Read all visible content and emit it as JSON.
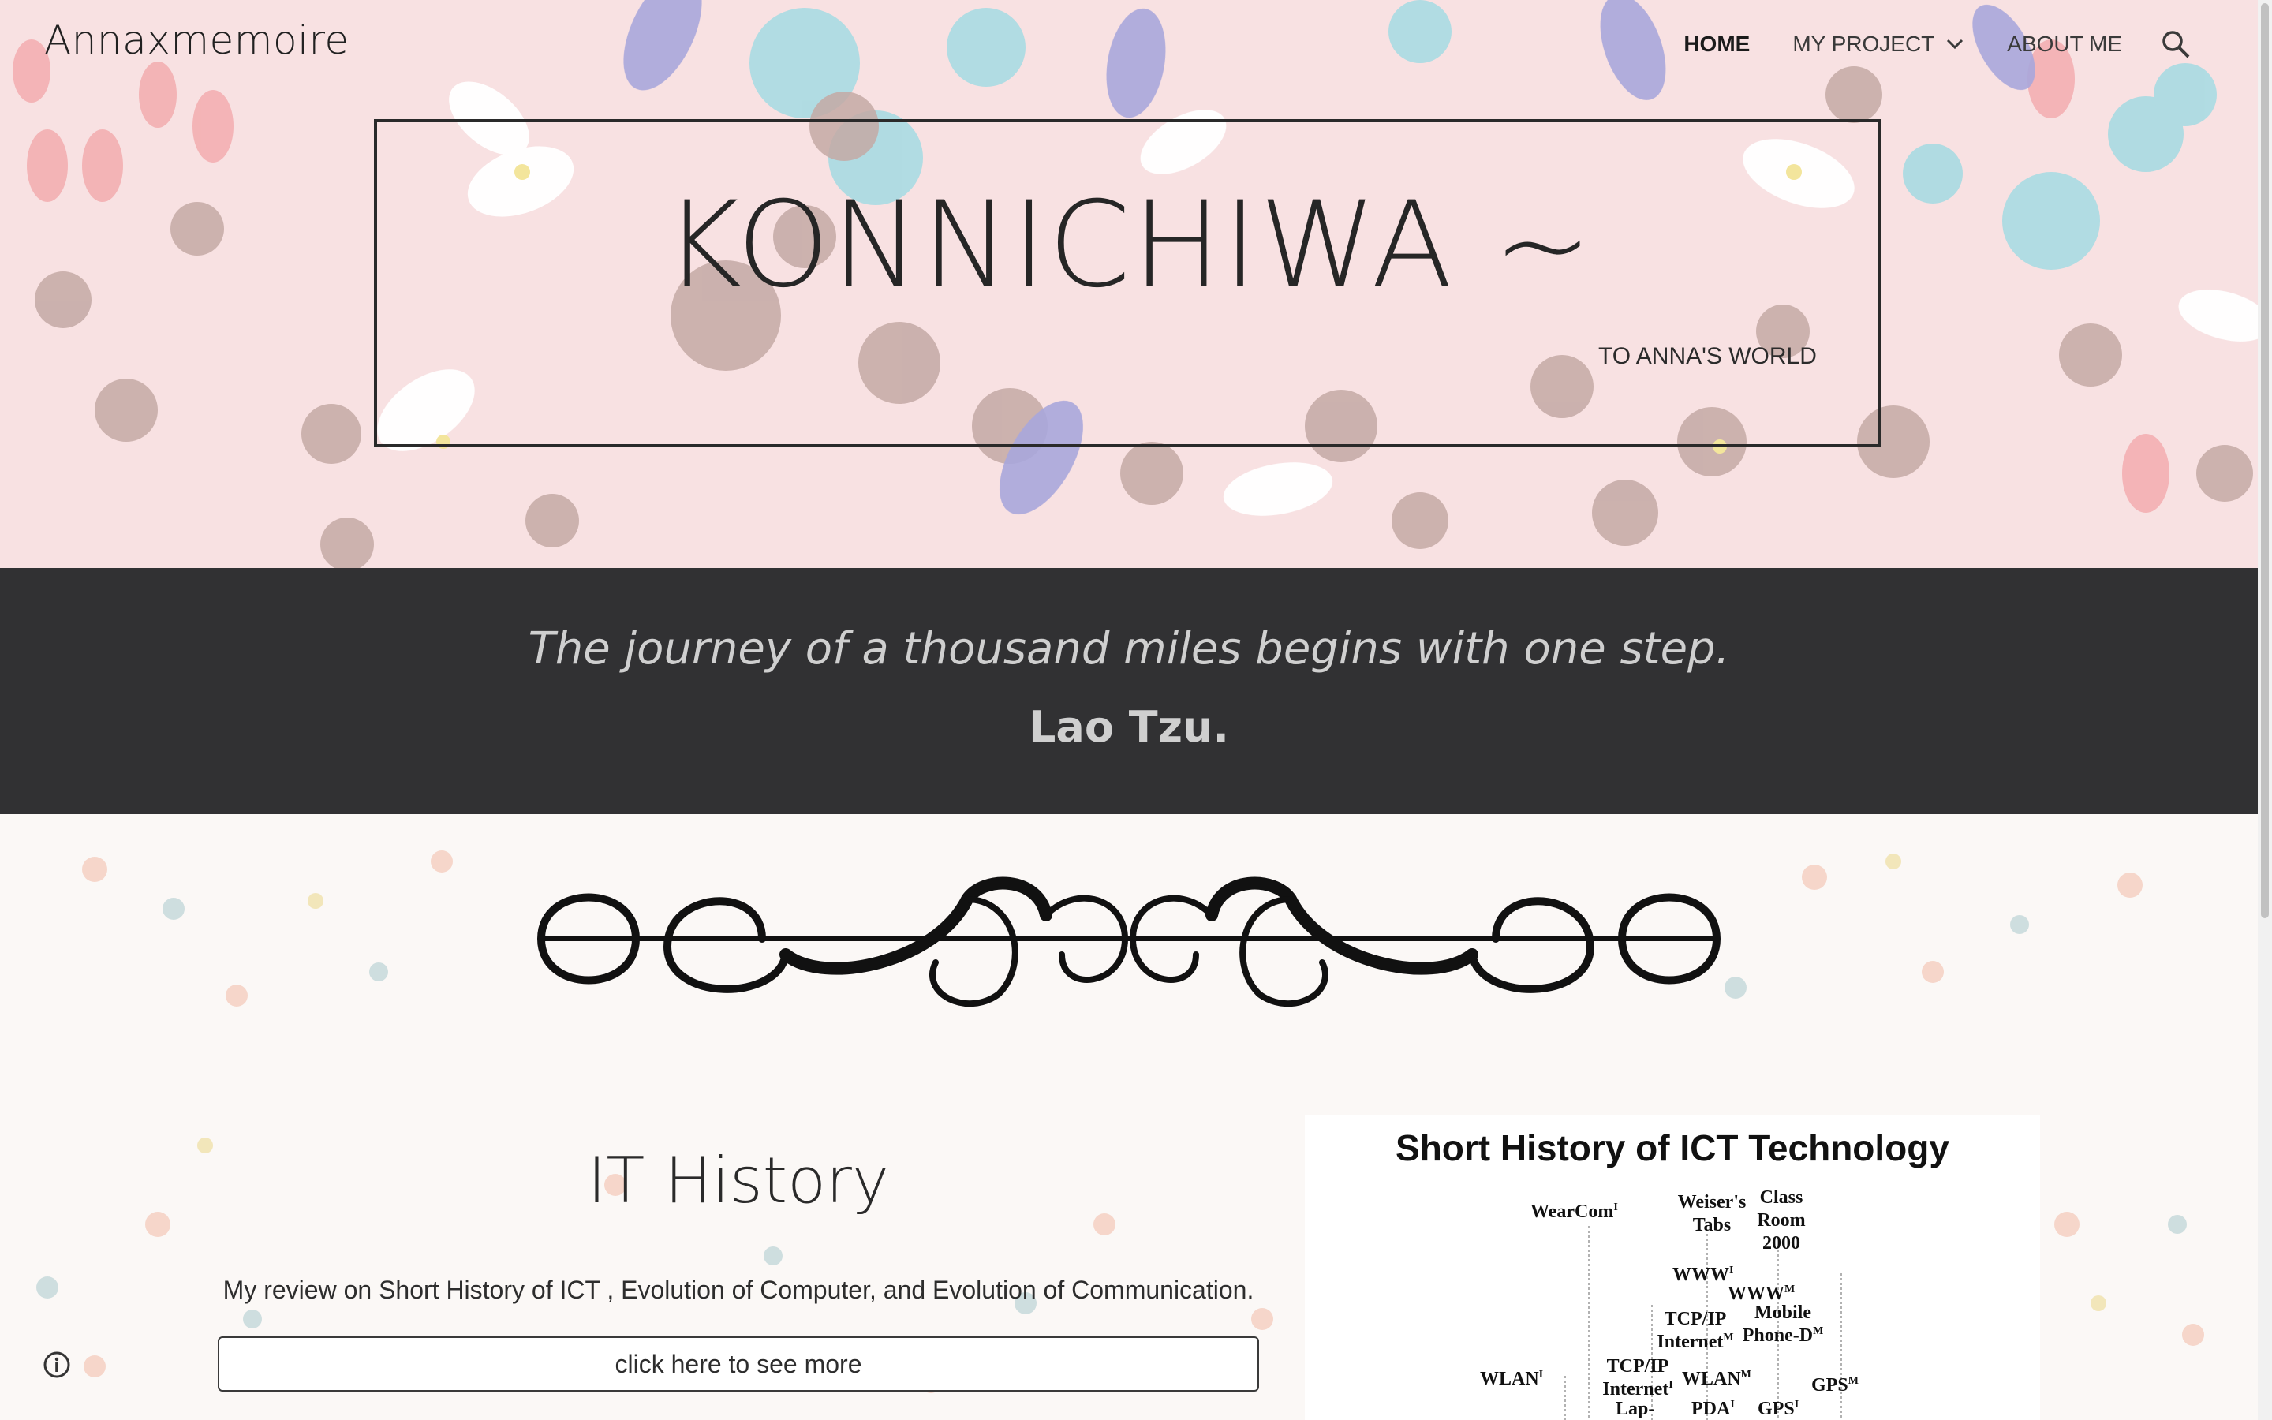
{
  "site": {
    "title": "Annaxmemoire"
  },
  "nav": {
    "items": [
      {
        "label": "HOME",
        "active": true
      },
      {
        "label": "MY PROJECT",
        "has_dropdown": true
      },
      {
        "label": "ABOUT ME"
      }
    ],
    "search_icon": "search-icon",
    "dropdown_icon": "chevron-down-icon"
  },
  "hero": {
    "heading": "KONNICHIWA ~",
    "subheading": "TO ANNA'S WORLD",
    "background": "pink floral pattern"
  },
  "quote": {
    "text": "The journey of a thousand miles begins with one step.",
    "author": "Lao Tzu."
  },
  "section": {
    "title": "IT History",
    "description": "My review on Short History of ICT , Evolution of Computer, and Evolution of Communication.",
    "button_label": "click here to see more"
  },
  "ict_image": {
    "title": "Short History of ICT Technology",
    "labels": [
      {
        "id": "wearcom",
        "text": "WearCom",
        "sup": "I"
      },
      {
        "id": "weisers-tabs",
        "text": "Weiser's Tabs"
      },
      {
        "id": "class-room",
        "text": "Class Room 2000"
      },
      {
        "id": "www1",
        "text": "WWW",
        "sup": "I"
      },
      {
        "id": "wwwm",
        "text": "WWW",
        "sup": "M"
      },
      {
        "id": "tcpip1",
        "text": "TCP/IP Internet",
        "sup": "M"
      },
      {
        "id": "mobile-phone",
        "text": "Mobile Phone-D",
        "sup": "M"
      },
      {
        "id": "tcpip2",
        "text": "TCP/IP Internet",
        "sup": "I"
      },
      {
        "id": "wlan1",
        "text": "WLAN",
        "sup": "I"
      },
      {
        "id": "wlanm",
        "text": "WLAN",
        "sup": "M"
      },
      {
        "id": "gpsm",
        "text": "GPS",
        "sup": "M"
      },
      {
        "id": "lap",
        "text": "Lap-"
      },
      {
        "id": "pda",
        "text": "PDA",
        "sup": "I"
      },
      {
        "id": "gps1",
        "text": "GPS",
        "sup": "I"
      }
    ]
  },
  "footer": {
    "info_icon": "info-icon"
  },
  "colors": {
    "hero_bg": "#f8e1e2",
    "quote_band": "#313133",
    "quote_text": "#cfcfcf",
    "text_dark": "#2a2a2a"
  }
}
